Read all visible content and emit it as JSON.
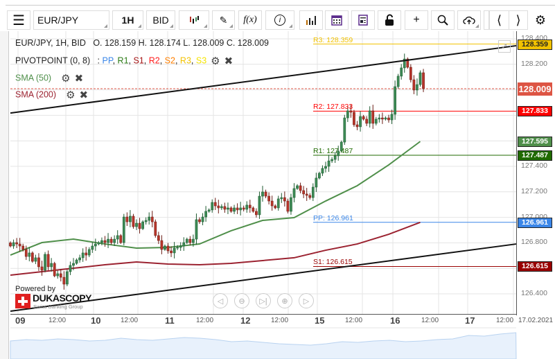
{
  "toolbar": {
    "instrument": "EUR/JPY",
    "period": "1H",
    "side": "BID",
    "icons": [
      "menu-icon",
      "candlestick-icon",
      "pencil-icon",
      "function-icon",
      "info-icon",
      "bar-chart-icon",
      "calendar-icon",
      "news-icon",
      "lock-icon",
      "crosshair-icon",
      "zoom-icon",
      "cloud-upload-icon",
      "chevron-left-icon",
      "chevron-right-icon",
      "gear-icon"
    ],
    "fx_label": "f(x)"
  },
  "legend": {
    "title": "EUR/JPY, 1H, BID",
    "ohlc": "O. 128.159 H. 128.174 L. 128.009 C. 128.009",
    "pivot": {
      "name": "PIVOTPOINT (0, 8)",
      "sep": ":",
      "items": [
        "PP",
        "R1",
        "S1",
        "R2",
        "S2",
        "R3",
        "S3"
      ]
    },
    "sma50": "SMA (50)",
    "sma200": "SMA (200)"
  },
  "colors": {
    "bull": "#3d8a55",
    "bear": "#b8352a",
    "sma50": "#4f8f4a",
    "sma200": "#9b2230",
    "pp": "#3a86e8",
    "r1": "#2a7a14",
    "s1": "#a31212",
    "r2": "#ff1a1a",
    "s2": "#ff7f00",
    "r3": "#f2c200",
    "s3": "#f5e400",
    "current": "#dd5544"
  },
  "pivots": [
    {
      "key": "R3",
      "label": "R3: 128.359",
      "value": 128.359,
      "box": "128.359",
      "color": "#f2c200",
      "boxText": "#222"
    },
    {
      "key": "R2",
      "label": "R2: 127.833",
      "value": 127.833,
      "box": "127.833",
      "color": "#ff0000",
      "boxText": "#fff"
    },
    {
      "key": "R1",
      "label": "R1: 127.487",
      "value": 127.487,
      "box": "127.487",
      "color": "#1f6a00",
      "boxText": "#fff"
    },
    {
      "key": "PP",
      "label": "PP: 126.961",
      "value": 126.961,
      "box": "126.961",
      "color": "#3a86e8",
      "boxText": "#fff"
    },
    {
      "key": "S1",
      "label": "S1: 126.615",
      "value": 126.615,
      "box": "126.615",
      "color": "#990000",
      "boxText": "#fff"
    }
  ],
  "current_price": {
    "value": 128.009,
    "box": "128.009"
  },
  "sma50_box": {
    "value": 127.595,
    "box": "127.595"
  },
  "y_axis": {
    "ticks": [
      "128.400",
      "128.200",
      "128.000",
      "127.800",
      "127.600",
      "127.400",
      "127.200",
      "127.000",
      "126.800",
      "126.600",
      "126.400"
    ],
    "range": [
      126.32,
      128.45
    ]
  },
  "x_axis": {
    "labels": [
      {
        "t": "09",
        "day": true
      },
      {
        "t": "12:00"
      },
      {
        "t": "10",
        "day": true
      },
      {
        "t": "12:00"
      },
      {
        "t": "11",
        "day": true
      },
      {
        "t": "12:00"
      },
      {
        "t": "12",
        "day": true
      },
      {
        "t": "12:00"
      },
      {
        "t": "15",
        "day": true
      },
      {
        "t": "12:00"
      },
      {
        "t": "16",
        "day": true
      },
      {
        "t": "12:00"
      },
      {
        "t": "17",
        "day": true
      },
      {
        "t": "12:00"
      },
      {
        "t": "17.02.2021"
      }
    ]
  },
  "branding": {
    "powered": "Powered by",
    "name": "DUKASCOPY",
    "tagline": "Swiss Banking Group"
  },
  "nav_buttons": [
    "scroll-left",
    "zoom-out",
    "reset",
    "zoom-in",
    "scroll-right"
  ],
  "chart_data": {
    "type": "candlestick",
    "closes": [
      126.775,
      126.802,
      126.791,
      126.775,
      126.748,
      126.693,
      126.721,
      126.655,
      126.683,
      126.612,
      126.585,
      126.71,
      126.612,
      126.639,
      126.541,
      126.558,
      126.53,
      126.476,
      126.574,
      126.623,
      126.639,
      126.666,
      126.683,
      126.721,
      126.704,
      126.748,
      126.775,
      126.791,
      126.802,
      126.818,
      126.802,
      126.829,
      126.802,
      126.829,
      126.857,
      126.802,
      127.003,
      126.965,
      127.009,
      126.927,
      126.954,
      126.911,
      126.965,
      126.976,
      127.003,
      126.965,
      126.857,
      126.818,
      126.748,
      126.775,
      126.737,
      126.721,
      126.759,
      126.764,
      126.775,
      126.802,
      126.829,
      126.802,
      126.829,
      126.982,
      126.965,
      127.003,
      127.047,
      127.058,
      127.117,
      127.09,
      127.074,
      127.085,
      127.063,
      127.074,
      127.047,
      127.074,
      127.058,
      127.074,
      127.063,
      127.096,
      127.074,
      127.047,
      127.02,
      127.166,
      127.199,
      127.166,
      127.128,
      127.09,
      127.074,
      127.145,
      127.155,
      127.128,
      127.047,
      127.155,
      127.226,
      127.248,
      127.21,
      127.183,
      127.172,
      127.155,
      127.237,
      127.308,
      127.346,
      127.384,
      127.4,
      127.443,
      127.454,
      127.482,
      127.52,
      127.59,
      127.78,
      127.835,
      127.824,
      127.726,
      127.71,
      127.791,
      127.77,
      127.737,
      127.835,
      127.737,
      127.77,
      127.78,
      127.77,
      127.78,
      127.764,
      127.808,
      128.025,
      128.107,
      128.172,
      128.242,
      128.177,
      128.079,
      127.998,
      128.041,
      128.134,
      128.009
    ],
    "sma50_every10": [
      126.704,
      126.802,
      126.829,
      126.791,
      126.759,
      126.764,
      126.791,
      126.895,
      126.976,
      126.998,
      127.128,
      127.248,
      127.411,
      127.595
    ],
    "sma200_every10": [
      126.547,
      126.574,
      126.601,
      126.628,
      126.65,
      126.634,
      126.628,
      126.639,
      126.661,
      126.683,
      126.742,
      126.791,
      126.867,
      126.961
    ],
    "trendlines": [
      {
        "from": 127.818,
        "to": 128.346
      },
      {
        "from": 126.264,
        "to": 126.791
      }
    ]
  }
}
